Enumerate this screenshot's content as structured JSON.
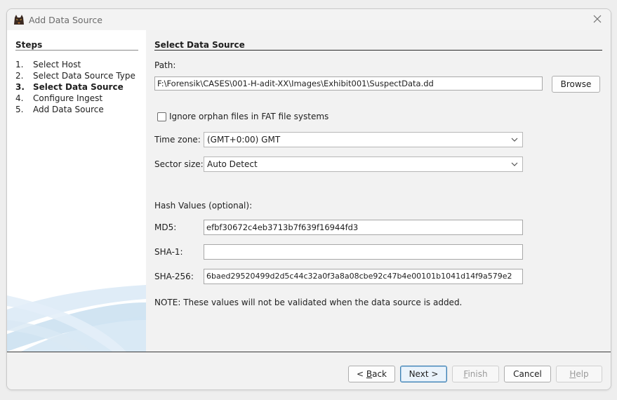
{
  "window": {
    "title": "Add Data Source"
  },
  "steps": {
    "title": "Steps",
    "items": [
      {
        "num": "1.",
        "label": "Select Host"
      },
      {
        "num": "2.",
        "label": "Select Data Source Type"
      },
      {
        "num": "3.",
        "label": "Select Data Source"
      },
      {
        "num": "4.",
        "label": "Configure Ingest"
      },
      {
        "num": "5.",
        "label": "Add Data Source"
      }
    ],
    "active_index": 2
  },
  "panel": {
    "title": "Select Data Source",
    "path_label": "Path:",
    "path_value": "F:\\Forensik\\CASES\\001-H-adit-XX\\Images\\Exhibit001\\SuspectData.dd",
    "browse_label": "Browse",
    "orphan_label": "Ignore orphan files in FAT file systems",
    "orphan_checked": false,
    "timezone_label": "Time zone:",
    "timezone_value": "(GMT+0:00) GMT",
    "sector_label": "Sector size:",
    "sector_value": "Auto Detect",
    "hash_heading": "Hash Values (optional):",
    "md5_label": "MD5:",
    "md5_value": "efbf30672c4eb3713b7f639f16944fd3",
    "sha1_label": "SHA-1:",
    "sha1_value": "",
    "sha256_label": "SHA-256:",
    "sha256_value": "6baed29520499d2d5c44c32a0f3a8a08cbe92c47b4e00101b1041d14f9a579e2",
    "note": "NOTE: These values will not be validated when the data source is added."
  },
  "footer": {
    "back_mn": "B",
    "back_rest": "ack",
    "back_prefix": "< ",
    "next_label": "Next >",
    "finish_mn": "F",
    "finish_rest": "inish",
    "cancel_label": "Cancel",
    "help_mn": "H",
    "help_rest": "elp"
  },
  "icons": {
    "app": "autopsy-dog-icon",
    "close": "close-icon",
    "chevron": "chevron-down-icon"
  }
}
